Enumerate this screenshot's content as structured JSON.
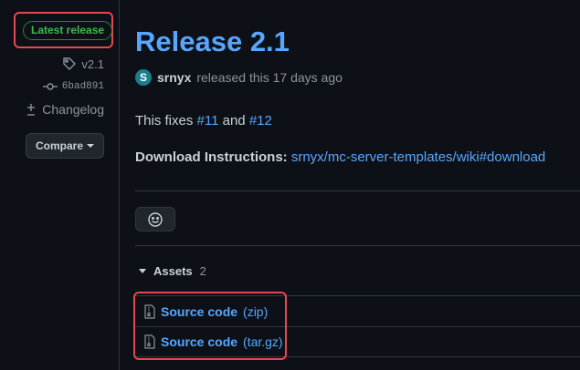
{
  "sidebar": {
    "latest_badge": "Latest release",
    "tag": "v2.1",
    "commit": "6bad891",
    "changelog": "Changelog",
    "compare": "Compare"
  },
  "release": {
    "title": "Release 2.1",
    "avatar_letter": "S",
    "author": "srnyx",
    "released_text": "released this 17 days ago",
    "fixes_prefix": "This fixes",
    "issue_a": "#11",
    "and_word": "and",
    "issue_b": "#12",
    "download_label": "Download Instructions:",
    "download_link": "srnyx/mc-server-templates/wiki#download"
  },
  "assets": {
    "label": "Assets",
    "count": "2",
    "items": [
      {
        "name": "Source code",
        "ext": "(zip)"
      },
      {
        "name": "Source code",
        "ext": "(tar.gz)"
      }
    ]
  },
  "colors": {
    "accent": "#58a6ff",
    "latest_green": "#3fb950",
    "highlight": "#e5484d"
  }
}
